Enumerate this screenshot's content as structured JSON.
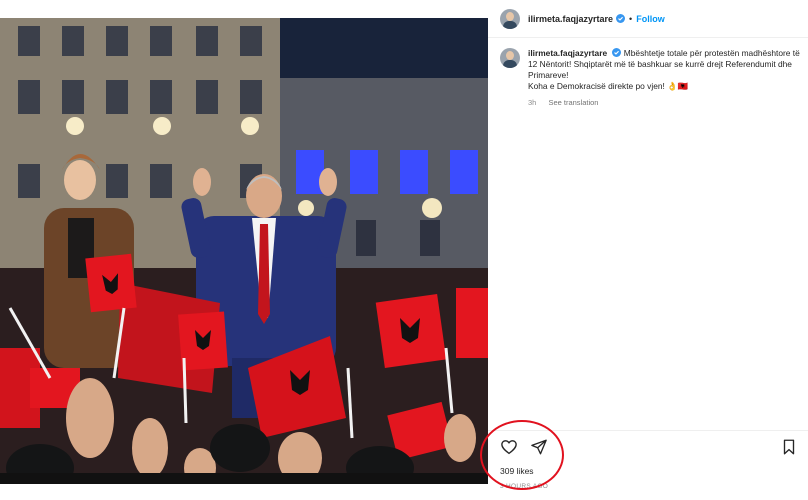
{
  "header": {
    "username": "ilirmeta.faqjazyrtare",
    "separator": "•",
    "follow_label": "Follow"
  },
  "caption": {
    "username": "ilirmeta.faqjazyrtare",
    "lines": [
      "Mbështetje totale për protestën madhështore të 12 Nëntorit! Shqiptarët më të bashkuar se kurrë drejt Referendumit dhe Primareve!",
      "Koha e Demokracisë direkte po vjen! 👌🇦🇱"
    ],
    "time": "3h",
    "see_translation": "See translation"
  },
  "actions": {
    "like_icon": "heart-icon",
    "share_icon": "paper-plane-icon",
    "save_icon": "bookmark-icon"
  },
  "likes": "309 likes",
  "time_ago": "3 HOURS AGO",
  "colors": {
    "link_blue": "#0095f6",
    "verified_blue": "#3897f0",
    "annotation_red": "#e1121f",
    "flag_red": "#e3161f"
  }
}
